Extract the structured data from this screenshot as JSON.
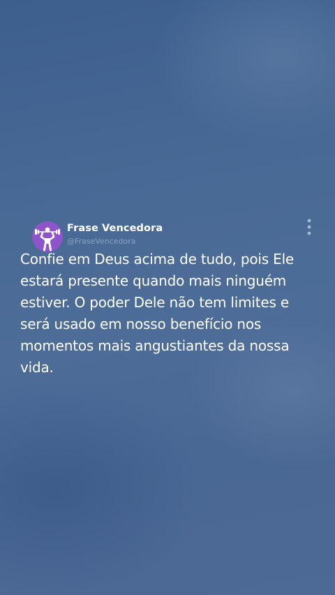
{
  "post": {
    "author": {
      "name": "Frase Vencedora",
      "handle": "@FraseVencedora",
      "avatar_icon": "strongman-lifting-weights-icon",
      "avatar_color": "#8d55c9"
    },
    "menu_icon": "vertical-ellipsis-icon",
    "text": "Confie em Deus acima de tudo, pois Ele estará presente quando mais ninguém estiver. O poder Dele não tem limites e será usado em nosso benefício nos momentos mais angustiantes da nossa vida."
  },
  "colors": {
    "background": "#4a6a96",
    "text": "#ffffff",
    "handle": "#8aa2c2"
  }
}
